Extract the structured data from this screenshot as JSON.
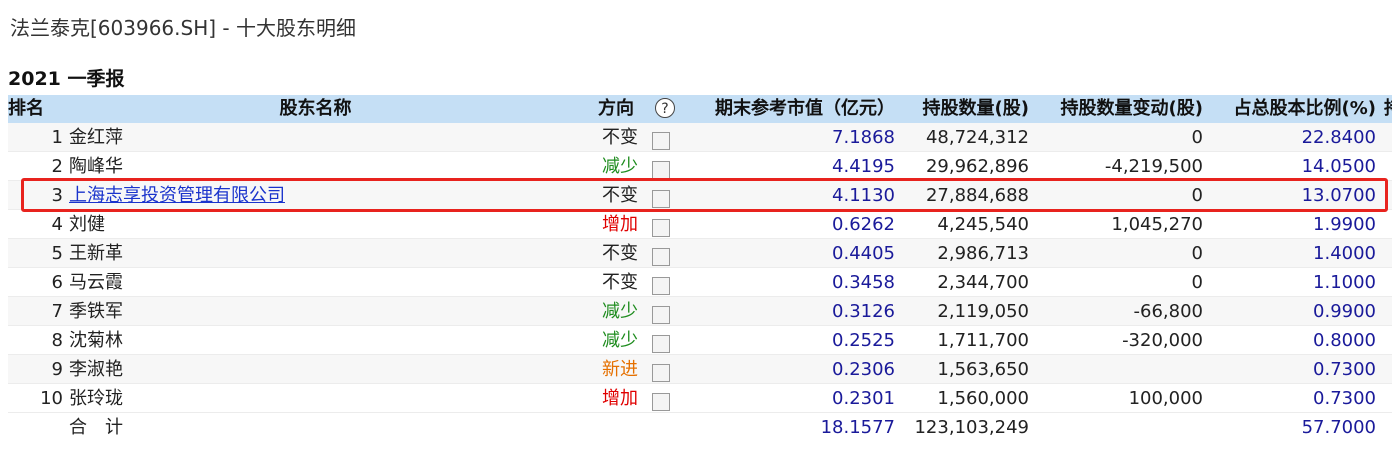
{
  "page": {
    "title": "法兰泰克[603966.SH] - 十大股东明细",
    "period": "2021 一季报"
  },
  "table": {
    "headers": {
      "rank": "排名",
      "name": "股东名称",
      "direction": "方向",
      "help": "?",
      "market_value": "期末参考市值（亿元）",
      "shares": "持股数量(股)",
      "change": "持股数量变动(股)",
      "percent": "占总股本比例(%)",
      "extra": "持"
    },
    "help_glyph": "?",
    "rows": [
      {
        "rank": "1",
        "name": "金红萍",
        "direction": "不变",
        "dir_class": "same",
        "market_value": "7.1868",
        "shares": "48,724,312",
        "change": "0",
        "percent": "22.8400",
        "is_link": false
      },
      {
        "rank": "2",
        "name": "陶峰华",
        "direction": "减少",
        "dir_class": "down",
        "market_value": "4.4195",
        "shares": "29,962,896",
        "change": "-4,219,500",
        "percent": "14.0500",
        "is_link": false
      },
      {
        "rank": "3",
        "name": "上海志享投资管理有限公司",
        "direction": "不变",
        "dir_class": "same",
        "market_value": "4.1130",
        "shares": "27,884,688",
        "change": "0",
        "percent": "13.0700",
        "is_link": true
      },
      {
        "rank": "4",
        "name": "刘健",
        "direction": "增加",
        "dir_class": "up",
        "market_value": "0.6262",
        "shares": "4,245,540",
        "change": "1,045,270",
        "percent": "1.9900",
        "is_link": false
      },
      {
        "rank": "5",
        "name": "王新革",
        "direction": "不变",
        "dir_class": "same",
        "market_value": "0.4405",
        "shares": "2,986,713",
        "change": "0",
        "percent": "1.4000",
        "is_link": false
      },
      {
        "rank": "6",
        "name": "马云霞",
        "direction": "不变",
        "dir_class": "same",
        "market_value": "0.3458",
        "shares": "2,344,700",
        "change": "0",
        "percent": "1.1000",
        "is_link": false
      },
      {
        "rank": "7",
        "name": "季铁军",
        "direction": "减少",
        "dir_class": "down",
        "market_value": "0.3126",
        "shares": "2,119,050",
        "change": "-66,800",
        "percent": "0.9900",
        "is_link": false
      },
      {
        "rank": "8",
        "name": "沈菊林",
        "direction": "减少",
        "dir_class": "down",
        "market_value": "0.2525",
        "shares": "1,711,700",
        "change": "-320,000",
        "percent": "0.8000",
        "is_link": false
      },
      {
        "rank": "9",
        "name": "李淑艳",
        "direction": "新进",
        "dir_class": "new",
        "market_value": "0.2306",
        "shares": "1,563,650",
        "change": "",
        "percent": "0.7300",
        "is_link": false
      },
      {
        "rank": "10",
        "name": "张玲珑",
        "direction": "增加",
        "dir_class": "up",
        "market_value": "0.2301",
        "shares": "1,560,000",
        "change": "100,000",
        "percent": "0.7300",
        "is_link": false
      }
    ],
    "total": {
      "label": "合　计",
      "market_value": "18.1577",
      "shares": "123,103,249",
      "percent": "57.7000"
    }
  },
  "colors": {
    "header_bg": "#c5dff5",
    "increase": "#e00000",
    "decrease": "#1e8c1e",
    "new": "#e57000",
    "value_blue": "#1a1a9a",
    "highlight_border": "#e8231e"
  }
}
